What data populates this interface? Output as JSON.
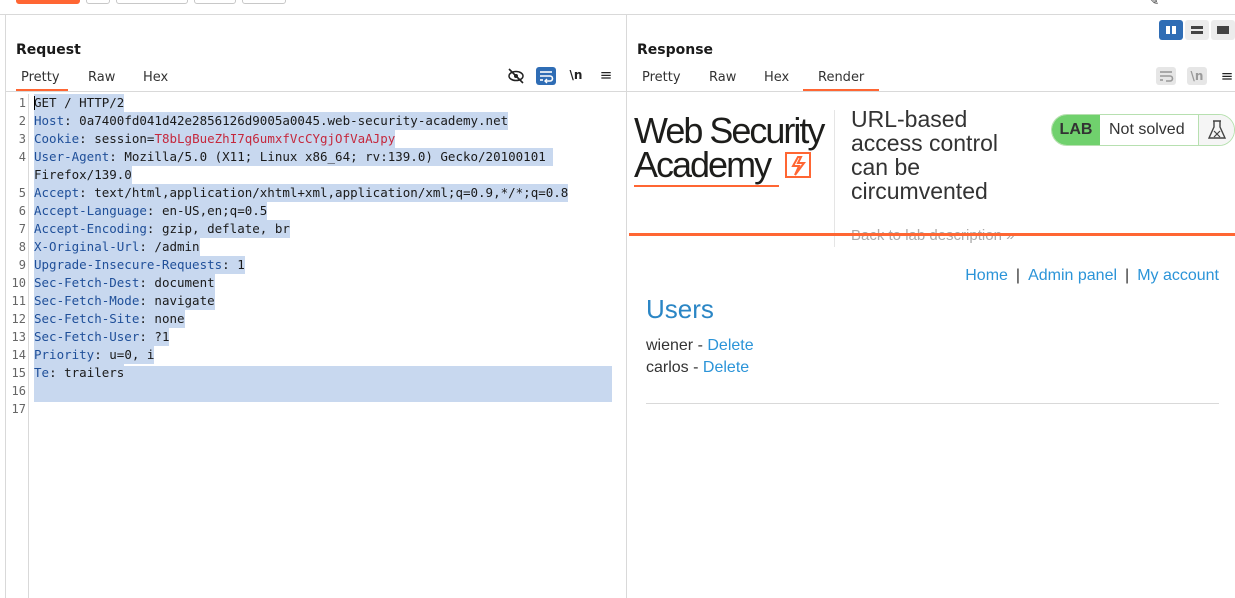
{
  "request": {
    "title": "Request",
    "tabs": [
      {
        "label": "Pretty",
        "active": true
      },
      {
        "label": "Raw",
        "active": false
      },
      {
        "label": "Hex",
        "active": false
      }
    ],
    "toolbar_icons": [
      "hide-eye-icon",
      "word-wrap-icon",
      "newline-icon",
      "menu-icon"
    ],
    "newline_label": "\\n",
    "lines": [
      {
        "n": "1",
        "key": "",
        "sep": "",
        "val": "GET / HTTP/2"
      },
      {
        "n": "2",
        "key": "Host",
        "sep": ": ",
        "val": "0a7400fd041d42e2856126d9005a0045.web-security-academy.net"
      },
      {
        "n": "3",
        "key": "Cookie",
        "sep": ": ",
        "val": "session=",
        "cookie": "T8bLgBueZhI7q6umxfVcCYgjOfVaAJpy"
      },
      {
        "n": "4",
        "key": "User-Agent",
        "sep": ": ",
        "val": "Mozilla/5.0 (X11; Linux x86_64; rv:139.0) Gecko/20100101 "
      },
      {
        "n": "",
        "key": "",
        "sep": "",
        "val": "Firefox/139.0"
      },
      {
        "n": "5",
        "key": "Accept",
        "sep": ": ",
        "val": "text/html,application/xhtml+xml,application/xml;q=0.9,*/*;q=0.8"
      },
      {
        "n": "6",
        "key": "Accept-Language",
        "sep": ": ",
        "val": "en-US,en;q=0.5"
      },
      {
        "n": "7",
        "key": "Accept-Encoding",
        "sep": ": ",
        "val": "gzip, deflate, br"
      },
      {
        "n": "8",
        "key": "X-Original-Url",
        "sep": ": ",
        "val": "/admin"
      },
      {
        "n": "9",
        "key": "Upgrade-Insecure-Requests",
        "sep": ": ",
        "val": "1"
      },
      {
        "n": "10",
        "key": "Sec-Fetch-Dest",
        "sep": ": ",
        "val": "document"
      },
      {
        "n": "11",
        "key": "Sec-Fetch-Mode",
        "sep": ": ",
        "val": "navigate"
      },
      {
        "n": "12",
        "key": "Sec-Fetch-Site",
        "sep": ": ",
        "val": "none"
      },
      {
        "n": "13",
        "key": "Sec-Fetch-User",
        "sep": ": ",
        "val": "?1"
      },
      {
        "n": "14",
        "key": "Priority",
        "sep": ": ",
        "val": "u=0, i"
      },
      {
        "n": "15",
        "key": "Te",
        "sep": ": ",
        "val": "trailers"
      },
      {
        "n": "16",
        "key": "",
        "sep": "",
        "val": ""
      },
      {
        "n": "17",
        "key": "",
        "sep": "",
        "val": ""
      }
    ]
  },
  "response": {
    "title": "Response",
    "tabs": [
      {
        "label": "Pretty",
        "active": false
      },
      {
        "label": "Raw",
        "active": false
      },
      {
        "label": "Hex",
        "active": false
      },
      {
        "label": "Render",
        "active": true
      }
    ],
    "newline_label": "\\n",
    "render": {
      "logo_line1": "Web Security",
      "logo_line2": "Academy",
      "lab_title": "URL-based access control can be circumvented",
      "back_link": "Back to lab description",
      "back_chevron": "»",
      "lab_tag": "LAB",
      "lab_status": "Not solved",
      "nav": {
        "home": "Home",
        "admin": "Admin panel",
        "account": "My account",
        "sep": "|"
      },
      "users_heading": "Users",
      "users": [
        {
          "name": "wiener",
          "dash": " - ",
          "action": "Delete"
        },
        {
          "name": "carlos",
          "dash": " - ",
          "action": "Delete"
        }
      ]
    }
  },
  "colors": {
    "accent": "#ff6633",
    "selection": "#c8d8ef",
    "header_key": "#1f4f99",
    "cookie_value": "#c5283d",
    "link": "#2b94d8",
    "lab_green": "#70d16d"
  }
}
